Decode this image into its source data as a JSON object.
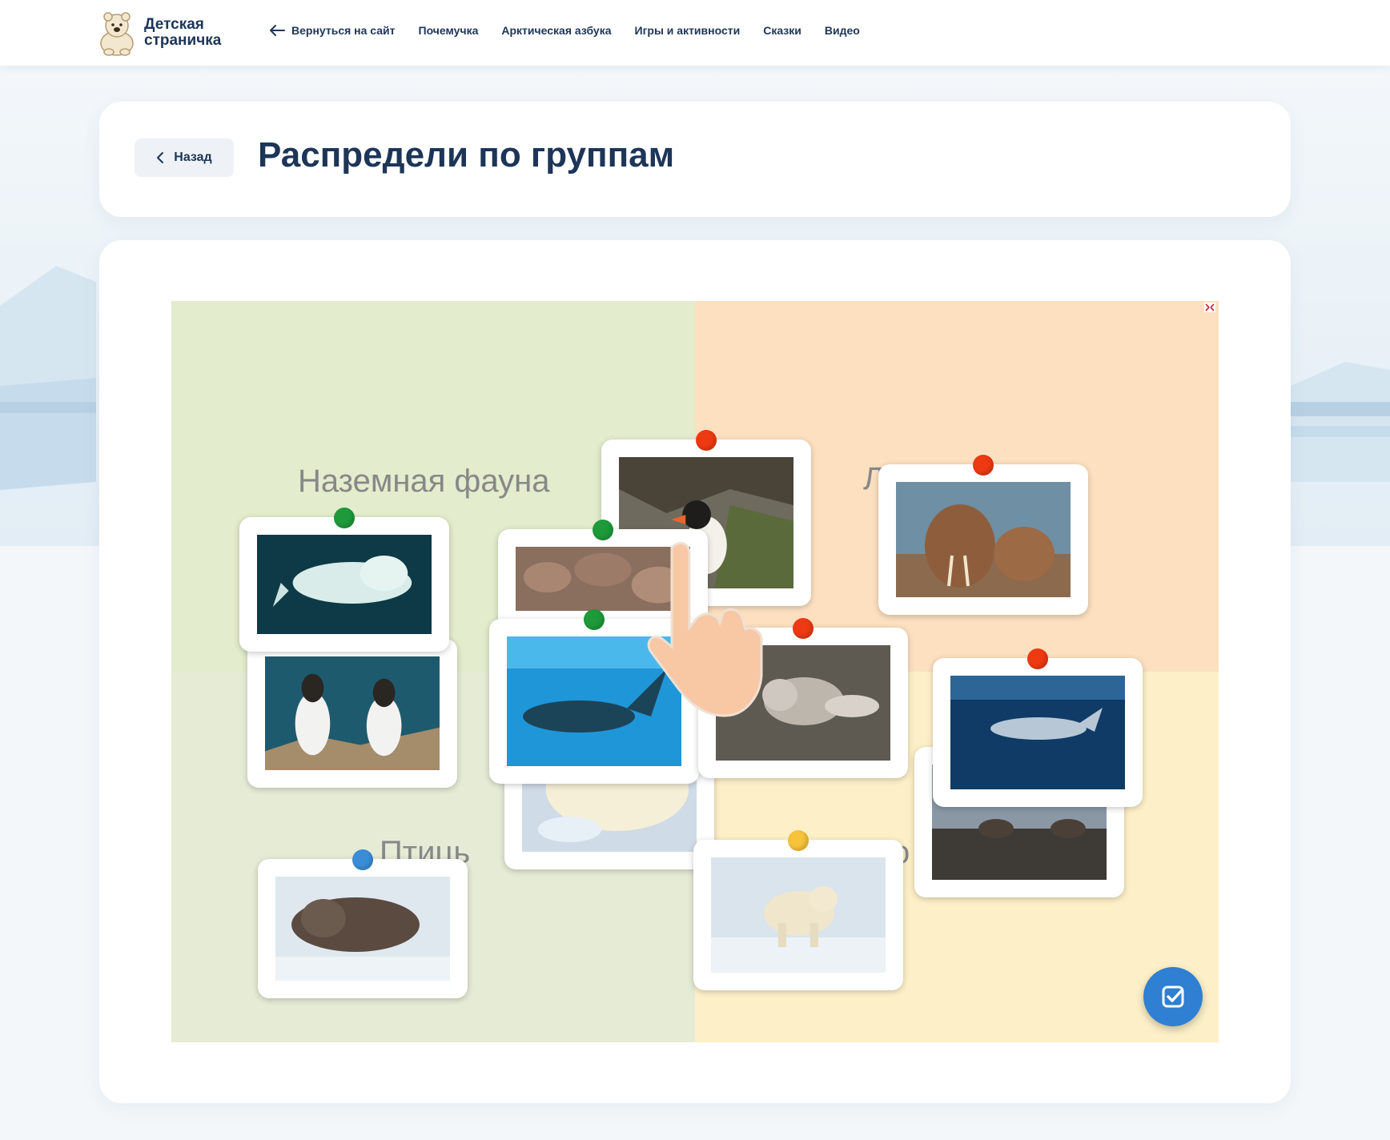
{
  "header": {
    "logo_line1": "Детская",
    "logo_line2": "страничка",
    "nav": {
      "back_to_site": "Вернуться на сайт",
      "items": [
        "Почемучка",
        "Арктическая азбука",
        "Игры и активности",
        "Сказки",
        "Видео"
      ]
    }
  },
  "title_card": {
    "back_label": "Назад",
    "title": "Распредели по группам"
  },
  "game": {
    "group_labels": {
      "land": "Наземная фауна",
      "top_right_fragment": "Л",
      "birds_fragment": "Птиць",
      "bottom_right_fragment": "о"
    },
    "cards": [
      {
        "subject": "beluga whale",
        "pin": "#1e9a3a"
      },
      {
        "subject": "guillemots",
        "pin": "#1e9a3a"
      },
      {
        "subject": "puffin",
        "pin": "#ee3a12"
      },
      {
        "subject": "rocks",
        "pin": "#1e9a3a"
      },
      {
        "subject": "bowhead whale",
        "pin": "#1e9a3a"
      },
      {
        "subject": "harp seal pup",
        "pin": "#1e9a3a"
      },
      {
        "subject": "bearded seal",
        "pin": "#3a8ed8"
      },
      {
        "subject": "walrus",
        "pin": "#ee3a12"
      },
      {
        "subject": "arctic fox",
        "pin": "#ee3a12"
      },
      {
        "subject": "reindeer",
        "pin": "#ee3a12"
      },
      {
        "subject": "whale underwater",
        "pin": "#ee3a12"
      },
      {
        "subject": "polar bear",
        "pin": "#f6c33a"
      }
    ],
    "icons": {
      "fullscreen": "fullscreen-icon",
      "check": "check-icon",
      "hand": "hand-pointer-icon"
    }
  },
  "colors": {
    "accent": "#1d3557",
    "check_button": "#2f7fd3"
  }
}
